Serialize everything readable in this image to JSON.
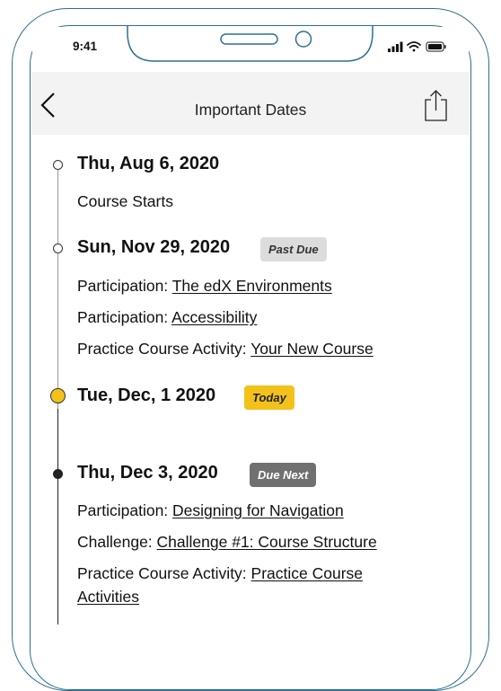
{
  "status_bar": {
    "time": "9:41"
  },
  "header": {
    "title": "Important Dates"
  },
  "dates": [
    {
      "heading": "Thu, Aug 6, 2020",
      "badge": "",
      "items": [
        {
          "prefix": "Course Starts",
          "link": ""
        }
      ]
    },
    {
      "heading": "Sun, Nov 29, 2020",
      "badge": "Past Due",
      "items": [
        {
          "prefix": "Participation: ",
          "link": "The edX Environments"
        },
        {
          "prefix": "Participation: ",
          "link": "Accessibility"
        },
        {
          "prefix": "Practice Course Activity: ",
          "link": "Your New Course"
        }
      ]
    },
    {
      "heading": "Tue, Dec, 1 2020",
      "badge": "Today",
      "items": []
    },
    {
      "heading": "Thu, Dec 3, 2020",
      "badge": "Due Next",
      "items": [
        {
          "prefix": "Participation: ",
          "link": "Designing for Navigation"
        },
        {
          "prefix": "Challenge: ",
          "link": "Challenge #1: Course Structure"
        },
        {
          "prefix": "Practice Course Activity: ",
          "link": "Practice Course"
        },
        {
          "prefix": "",
          "link": "Activities"
        }
      ]
    }
  ],
  "colors": {
    "frame": "#2e6f8e",
    "today": "#f2c21b",
    "past_due": "#dcdcdc",
    "due_next": "#707070"
  }
}
